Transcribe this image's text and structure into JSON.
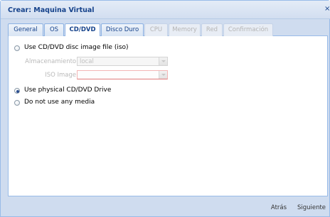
{
  "window": {
    "title": "Crear: Maquina Virtual",
    "close_symbol": "×"
  },
  "tabs": [
    {
      "label": "General",
      "state": "normal"
    },
    {
      "label": "OS",
      "state": "normal"
    },
    {
      "label": "CD/DVD",
      "state": "active"
    },
    {
      "label": "Disco Duro",
      "state": "normal"
    },
    {
      "label": "CPU",
      "state": "disabled"
    },
    {
      "label": "Memory",
      "state": "disabled"
    },
    {
      "label": "Red",
      "state": "disabled"
    },
    {
      "label": "Confirmación",
      "state": "disabled"
    }
  ],
  "form": {
    "option_iso": {
      "label": "Use CD/DVD disc image file (iso)",
      "checked": false
    },
    "storage": {
      "label": "Almacenamiento:",
      "value": "local"
    },
    "iso_image": {
      "label": "ISO Image:",
      "value": ""
    },
    "option_physical": {
      "label": "Use physical CD/DVD Drive",
      "checked": true
    },
    "option_none": {
      "label": "Do not use any media",
      "checked": false
    }
  },
  "footer": {
    "back_label": "Atrás",
    "next_label": "Siguiente"
  }
}
